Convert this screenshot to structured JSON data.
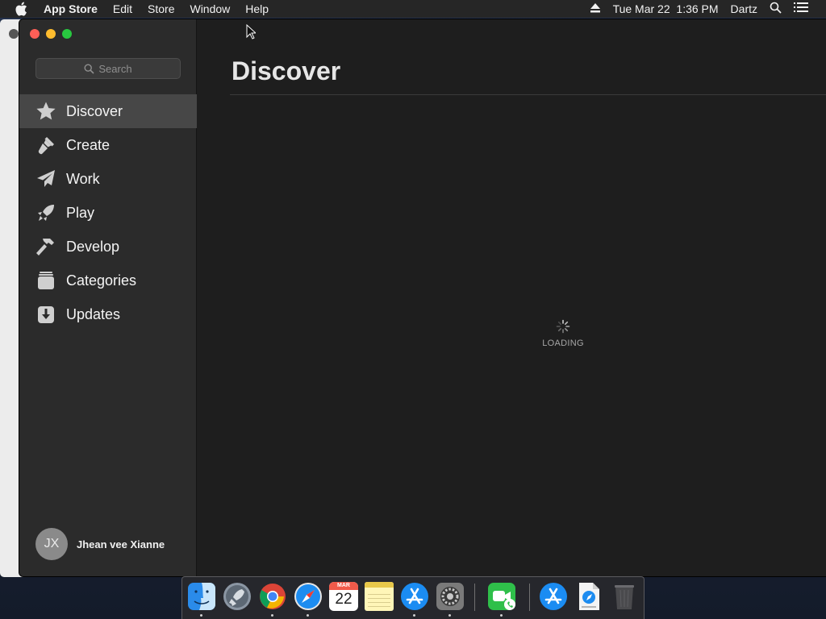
{
  "menubar": {
    "app_name": "App Store",
    "menus": [
      "Edit",
      "Store",
      "Window",
      "Help"
    ],
    "clock": "Tue Mar 22  1:36 PM",
    "user": "Dartz"
  },
  "sidebar": {
    "search_placeholder": "Search",
    "items": [
      {
        "label": "Discover",
        "icon": "star-icon",
        "active": true
      },
      {
        "label": "Create",
        "icon": "brush-icon"
      },
      {
        "label": "Work",
        "icon": "paper-plane-icon"
      },
      {
        "label": "Play",
        "icon": "rocket-icon"
      },
      {
        "label": "Develop",
        "icon": "hammer-icon"
      },
      {
        "label": "Categories",
        "icon": "stack-icon"
      },
      {
        "label": "Updates",
        "icon": "download-icon"
      }
    ],
    "user": {
      "initials": "JX",
      "name": "Jhean vee Xianne"
    }
  },
  "main": {
    "title": "Discover",
    "loading_text": "LOADING"
  },
  "dock": {
    "items": [
      {
        "name": "finder-icon",
        "running": true
      },
      {
        "name": "launchpad-icon",
        "running": false
      },
      {
        "name": "chrome-icon",
        "running": true
      },
      {
        "name": "safari-icon",
        "running": true
      },
      {
        "name": "calendar-icon",
        "running": false,
        "month": "MAR",
        "day": "22"
      },
      {
        "name": "notes-icon",
        "running": false
      },
      {
        "name": "app-store-icon",
        "running": true
      },
      {
        "name": "system-preferences-icon",
        "running": true
      },
      {
        "name": "facetime-icon",
        "running": true
      },
      {
        "name": "app-store-download-icon",
        "running": false
      },
      {
        "name": "downloads-stack-icon",
        "running": false
      },
      {
        "name": "trash-icon",
        "running": false
      }
    ]
  },
  "colors": {
    "sidebar_bg": "#2b2b2b",
    "sidebar_active": "#474747",
    "content_bg": "#1e1e1e",
    "close": "#fe5f57",
    "minimize": "#febc2e",
    "maximize": "#28c840"
  }
}
